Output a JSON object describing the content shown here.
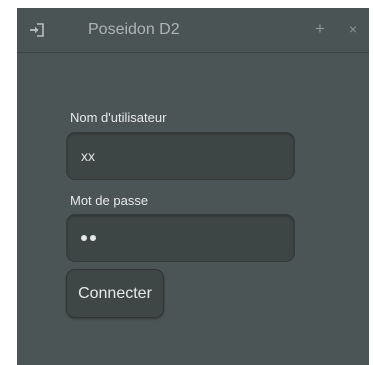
{
  "window": {
    "title": "Poseidon D2",
    "icons": {
      "left": "login-icon",
      "plus": "+",
      "close": "×"
    }
  },
  "login": {
    "username_label": "Nom d'utilisateur",
    "username_value": "xx",
    "password_label": "Mot de passe",
    "password_masked_length": 2,
    "submit_label": "Connecter"
  },
  "colors": {
    "window_bg": "#4c5555",
    "input_bg": "#3d4545",
    "text": "#e6e9e9",
    "title_text": "#aeb4b4"
  }
}
